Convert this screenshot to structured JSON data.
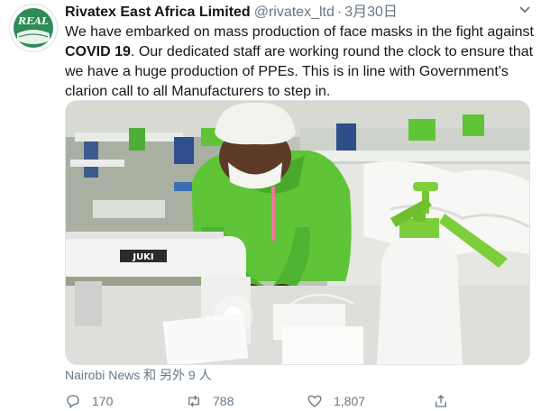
{
  "tweet": {
    "author": {
      "display_name": "Rivatex East Africa Limited",
      "handle": "@rivatex_ltd",
      "separator": "·",
      "date": "3月30日",
      "avatar_text": "REAL",
      "avatar_icon": "rivatex-logo-icon"
    },
    "more_icon": "chevron-down-icon",
    "text": {
      "part1": "We have embarked on mass production of face masks in the fight against ",
      "bold": "COVID 19",
      "part2": ". Our dedicated staff are working round the clock to ensure that we have a huge production of PPEs. This is in line with Government's clarion call to all Manufacturers to step in."
    },
    "photo": {
      "machine_brand": "JUKI"
    },
    "tagged": "Nairobi News 和 另外 9 人",
    "actions": {
      "reply": {
        "icon": "reply-icon",
        "count": "170"
      },
      "retweet": {
        "icon": "retweet-icon",
        "count": "788"
      },
      "like": {
        "icon": "heart-icon",
        "count": "1,807"
      },
      "share": {
        "icon": "share-icon"
      }
    }
  },
  "colors": {
    "text": "#14171a",
    "secondary": "#657786",
    "worker_green": "#5fc437",
    "sprayer_green": "#7ccf3a",
    "logo_green": "#2e8b57"
  }
}
